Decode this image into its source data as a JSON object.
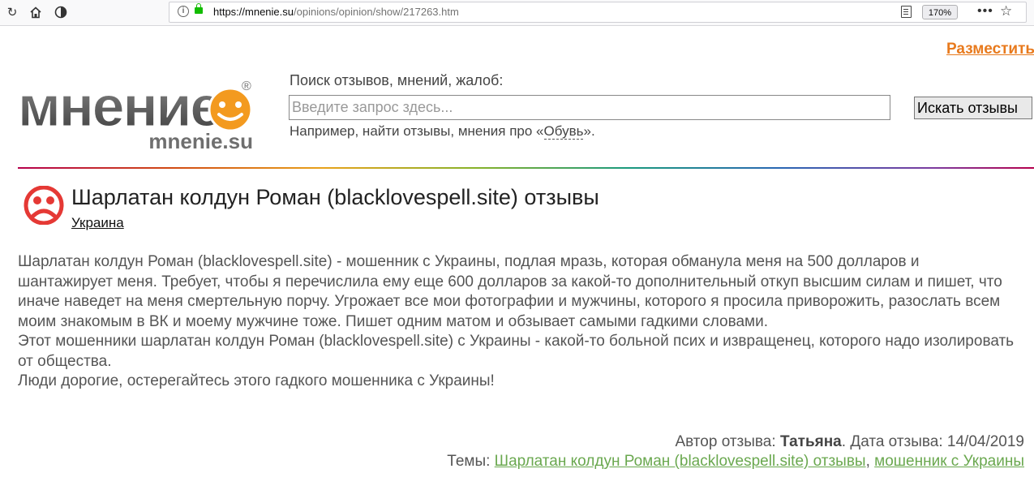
{
  "browser": {
    "url_host": "https://mnenie.su",
    "url_path": "/opinions/opinion/show/217263.htm",
    "zoom": "170%"
  },
  "header": {
    "post_link": "Разместить",
    "logo_main": "мнение",
    "logo_sub": "mnenie.su",
    "logo_reg": "®",
    "search_label": "Поиск отзывов, мнений, жалоб:",
    "search_placeholder": "Введите запрос здесь...",
    "search_button": "Искать отзывы",
    "example_prefix": "Например, найти отзывы, мнения про «",
    "example_link": "Обувь",
    "example_suffix": "»."
  },
  "opinion": {
    "title": "Шарлатан колдун Роман (blacklovespell.site) отзывы",
    "country": "Украина",
    "paragraphs": [
      "Шарлатан колдун Роман (blacklovespell.site) - мошенник с Украины, подлая мразь, которая обманула меня на 500 долларов и шантажирует меня. Требует, чтобы я перечислила ему еще 600 долларов за какой-то дополнительный откуп высшим силам и пишет, что иначе наведет на меня смертельную порчу. Угрожает все мои фотографии и мужчины, которого я просила приворожить, разослать всем моим знакомым в ВК и моему мужчине тоже. Пишет одним матом и обзывает самыми гадкими словами.",
      "Этот мошенники шарлатан колдун Роман (blacklovespell.site) с Украины - какой-то больной псих и извращенец, которого надо изолировать от общества.",
      "Люди дорогие, остерегайтесь этого гадкого мошенника с Украины!"
    ],
    "author_label": "Автор отзыва: ",
    "author": "Татьяна",
    "date_label": ". Дата отзыва: ",
    "date": "14/04/2019",
    "topics_label": "Темы: ",
    "topics": [
      "Шарлатан колдун Роман (blacklovespell.site) отзывы",
      "мошенник с Украины"
    ],
    "topics_sep": ", "
  }
}
